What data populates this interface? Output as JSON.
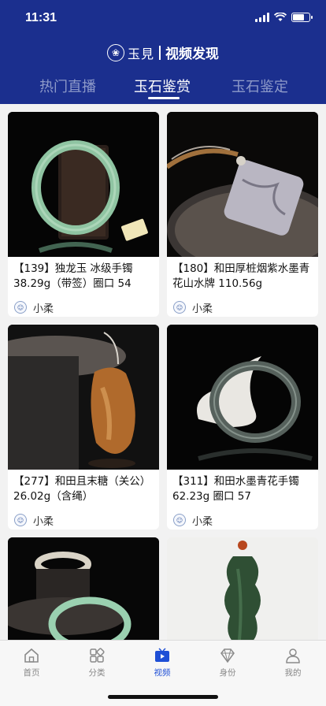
{
  "status_bar": {
    "time": "11:31"
  },
  "brand": {
    "logo_text": "玉見",
    "title": "视频发现"
  },
  "tabs": [
    {
      "label": "热门直播"
    },
    {
      "label": "玉石鉴赏"
    },
    {
      "label": "玉石鉴定"
    }
  ],
  "cards": [
    {
      "title": "【139】独龙玉 冰级手镯38.29g（带签）圈口 54",
      "author": "小柔"
    },
    {
      "title": "【180】和田厚桩烟紫水墨青花山水牌 110.56g",
      "author": "小柔"
    },
    {
      "title": "【277】和田且末糖（关公） 26.02g（含绳）",
      "author": "小柔"
    },
    {
      "title": "【311】和田水墨青花手镯62.23g 圈口 57",
      "author": "小柔"
    },
    {
      "title": "",
      "author": ""
    },
    {
      "title": "",
      "author": ""
    }
  ],
  "tabbar": [
    {
      "label": "首页",
      "icon": "home-icon"
    },
    {
      "label": "分类",
      "icon": "category-icon"
    },
    {
      "label": "视频",
      "icon": "video-icon"
    },
    {
      "label": "身份",
      "icon": "diamond-icon"
    },
    {
      "label": "我的",
      "icon": "user-icon"
    }
  ],
  "colors": {
    "header_bg": "#1b2f8e",
    "tab_active": "#1e4fd6"
  }
}
